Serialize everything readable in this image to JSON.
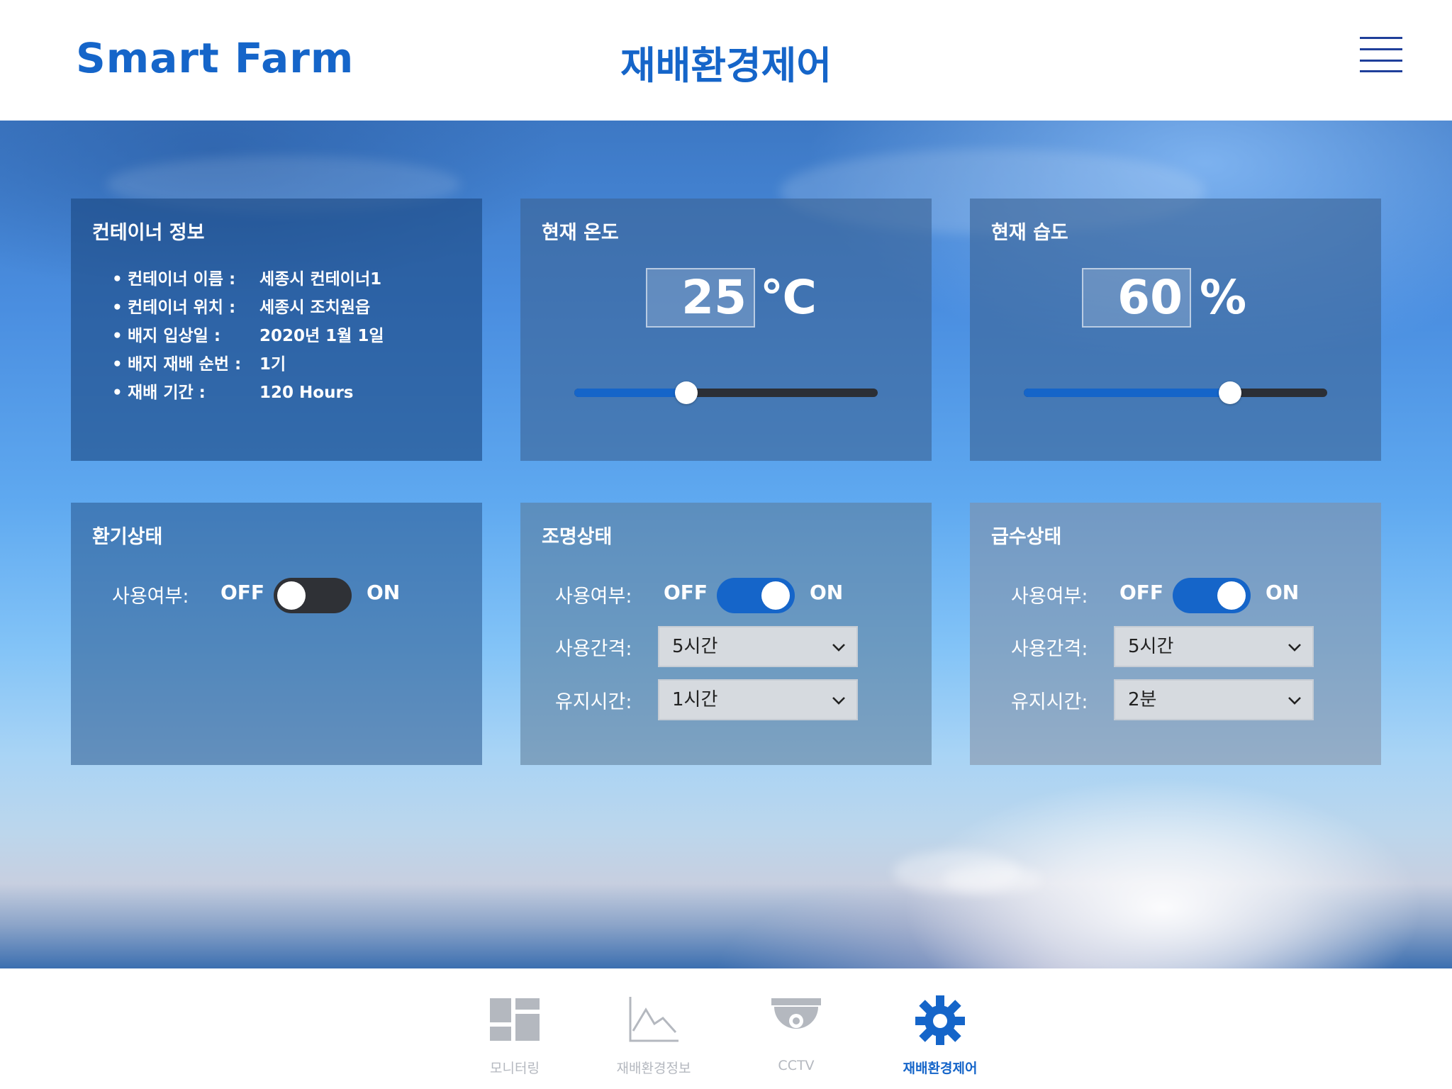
{
  "header": {
    "brand": "Smart Farm",
    "title": "재배환경제어",
    "menu_icon": "hamburger-menu-icon"
  },
  "container_info": {
    "title": "컨테이너 정보",
    "items": [
      {
        "key": "컨테이너 이름 :",
        "value": "세종시 컨테이너1"
      },
      {
        "key": "컨테이너 위치 :",
        "value": "세종시 조치원읍"
      },
      {
        "key": "배지 입상일 :",
        "value": "2020년 1월 1일"
      },
      {
        "key": "배지 재배 순번 :",
        "value": "1기"
      },
      {
        "key": "재배 기간 :",
        "value": "120 Hours"
      }
    ]
  },
  "temperature": {
    "title": "현재 온도",
    "value": "25",
    "unit": "℃",
    "slider_fraction": 0.37
  },
  "humidity": {
    "title": "현재 습도",
    "value": "60",
    "unit": "%",
    "slider_fraction": 0.68
  },
  "ventilation": {
    "title": "환기상태",
    "use_label": "사용여부:",
    "off": "OFF",
    "on": "ON",
    "enabled": false
  },
  "lighting": {
    "title": "조명상태",
    "use_label": "사용여부:",
    "off": "OFF",
    "on": "ON",
    "enabled": true,
    "interval_label": "사용간격:",
    "interval_value": "5시간",
    "duration_label": "유지시간:",
    "duration_value": "1시간"
  },
  "watering": {
    "title": "급수상태",
    "use_label": "사용여부:",
    "off": "OFF",
    "on": "ON",
    "enabled": true,
    "interval_label": "사용간격:",
    "interval_value": "5시간",
    "duration_label": "유지시간:",
    "duration_value": "2분"
  },
  "bottom_nav": {
    "items": [
      {
        "label": "모니터링",
        "icon": "dashboard-icon",
        "active": false
      },
      {
        "label": "재배환경정보",
        "icon": "line-chart-icon",
        "active": false
      },
      {
        "label": "CCTV",
        "icon": "cctv-camera-icon",
        "active": false
      },
      {
        "label": "재배환경제어",
        "icon": "gear-icon",
        "active": true
      }
    ]
  },
  "colors": {
    "accent": "#1565c9",
    "toggle_off": "#2f3136",
    "nav_inactive": "#b4b8bf"
  }
}
